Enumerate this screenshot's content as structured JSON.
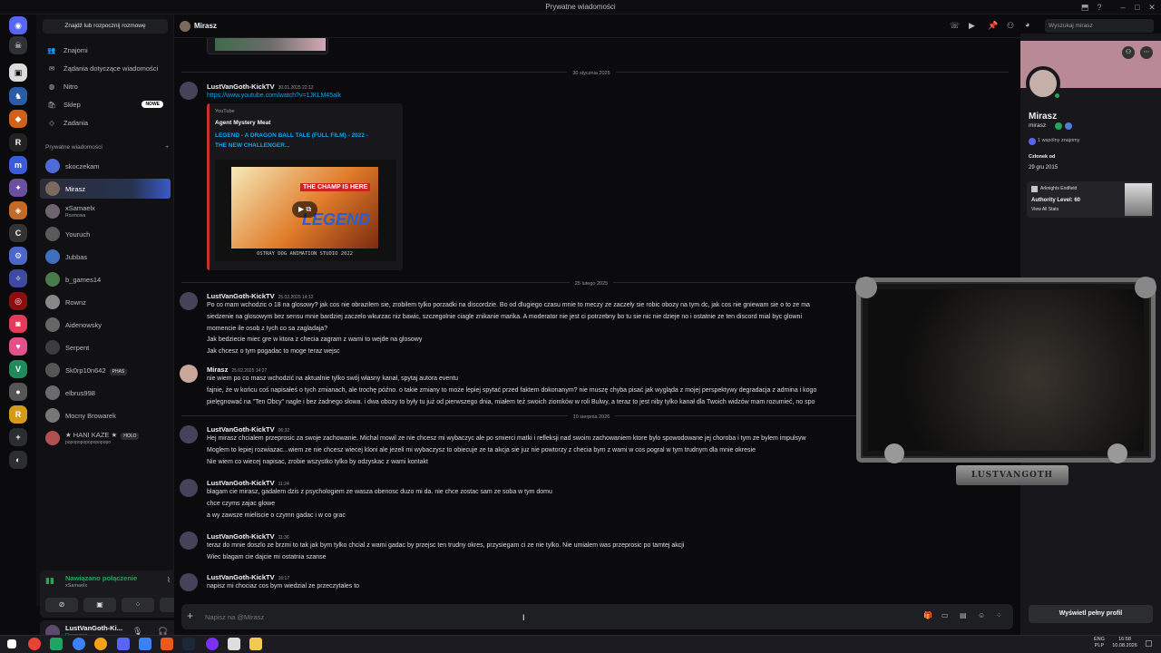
{
  "window": {
    "title": "Prywatne wiadomości"
  },
  "sidebar": {
    "find_button": "Znajdź lub rozpocznij rozmowę",
    "nav": [
      {
        "label": "Znajomi"
      },
      {
        "label": "Żądania dotyczące wiadomości"
      },
      {
        "label": "Nitro"
      },
      {
        "label": "Sklep",
        "badge": "NOWE"
      },
      {
        "label": "Zadania"
      }
    ],
    "dm_header": "Prywatne wiadomości",
    "dm_add": "+",
    "dms": [
      {
        "name": "skoczekam",
        "sub": "",
        "color": "#4f6bd9"
      },
      {
        "name": "Mirasz",
        "sub": "",
        "color": "#7a6a5e"
      },
      {
        "name": "xSamaelx",
        "sub": "Rozmowa",
        "color": "#6d6470"
      },
      {
        "name": "Youruch",
        "sub": "",
        "color": "#5a5a5a"
      },
      {
        "name": "Jubbas",
        "sub": "",
        "color": "#3f6fbf"
      },
      {
        "name": "b_games14",
        "sub": "",
        "color": "#4b7a4b"
      },
      {
        "name": "Rownz",
        "sub": "",
        "color": "#888"
      },
      {
        "name": "Aidenowsky",
        "sub": "",
        "color": "#666"
      },
      {
        "name": "Serpent",
        "sub": "",
        "color": "#3d3d3d"
      },
      {
        "name": "Sk0rp10n642",
        "sub": "",
        "tag": "PHAS",
        "color": "#555"
      },
      {
        "name": "elbrus998",
        "sub": "",
        "color": "#6b6b6b"
      },
      {
        "name": "Mocny Browarek",
        "sub": "",
        "color": "#777"
      },
      {
        "name": "★ HANI KAZE ★",
        "sub": "popopopopopopopopo",
        "tag": "HOLO",
        "color": "#b05050"
      }
    ],
    "voice": {
      "status": "Nawiązano połączenie",
      "channel": "xSamaelx"
    },
    "user": {
      "name": "LustVanGoth-Ki...",
      "status": "Rozmowa"
    }
  },
  "chat": {
    "header_name": "Mirasz",
    "search_placeholder": "Wyszukaj mirasz",
    "composer_placeholder": "Napisz na @Mirasz",
    "date_dividers": [
      "30 stycznia 2025",
      "25 lutego 2025",
      "10 sierpnia 2026"
    ],
    "embed": {
      "provider": "YouTube",
      "channel": "Agent Mystery Meat",
      "title_line1": "LEGEND - A DRAGON BALL TALE (FULL FILM) - 2022 -",
      "title_line2": "THE NEW CHALLENGER...",
      "thumb_text1": "THE CHAMP IS HERE",
      "thumb_text2": "LEGEND",
      "thumb_text3": "OSTRAY DOG ANIMATION STUDIO  2022"
    },
    "messages": [
      {
        "author": "LustVanGoth-KickTV",
        "time": "30.01.2025 22:12",
        "lines": [
          "https://www.youtube.com/watch?v=1JKLM45alk"
        ]
      },
      {
        "author": "LustVanGoth-KickTV",
        "time": "25.02.2025 14:12",
        "lines": [
          "Po co mam wchodzic o 18 na glosowy?  jak cos nie obrazilem sie, zrobilem tylko porzadki na discordzie. Bo od dlugiego czasu mnie to meczy ze zaczely sie robic obozy na tym dc,  jak cos nie gniewam sie o to ze ma",
          "siedzenie na glosowym bez sensu mnie bardziej zaczelo wkurzac niz bawic, szczegolnie ciagle znikanie marika. A moderator nie jest ci potrzebny bo tu sie nic nie dzieje   no i ostatnie ze ten discord mial byc glowni",
          "momencie ile osob z tych co sa zagladaja? ",
          "Jak bedziecie miec gre w ktora z checia zagram z wami to wejde na glosowy",
          "Jak chcesz o tym pogadac to moge teraz wejsc "
        ]
      },
      {
        "author": "Mirasz",
        "time": "25.02.2025 14:27",
        "lines": [
          "nie wiem po co masz wchodzić na aktualnie tylko swój własny kanał, spytaj autora eventu ",
          "fajnie, że w końcu coś napisałeś o tych zmianach, ale trochę późno. o takie zmiany to może lepiej spytać przed faktem dokonanym? nie muszę chyba pisać jak wygląda z mojej perspektywy degradacja z admina i kogo",
          "pielęgnować na \"Ten Obcy\" nagle i bez żadnego słowa. i dwa obozy to były tu już od pierwszego dnia, miałem też swoich ziomków w roli Bulwy, a teraz to jest niby tylko kanał dla Twoich widzów mam rozumieć, no spo"
        ]
      },
      {
        "author": "LustVanGoth-KickTV",
        "time": "06:32",
        "lines": [
          "Hej mirasz chcialem przeprosic za swoje zachowanie. Michal mowil ze nie chcesz mi wybaczyc ale po smierci matki i refleksji nad swoim zachowaniem ktore bylo spowodowane jej choroba i tym ze bylem impulsyw",
          "Moglem to lepiej rozwiazac...wiem ze nie chcesz wiecej kloni ale jezeli mi wybaczysz to obiecuje ze ta akcja sie juz nie powtorzy   z checia bym z wami w cos pogral w tym trudnym dla mnie okresie",
          "Nie wiem co wiecej napisac, zrobie wszystko tylko by odzyskac z wami kontakt"
        ]
      },
      {
        "author": "LustVanGoth-KickTV",
        "time": "11:24",
        "lines": [
          "blagam cie mirasz, gadalem dzis z psychologiem ze wasza obenosc duzo mi da.   nie chce zostac sam ze soba w tym domu ",
          "chce czyms zajac glowe",
          "a wy zawsze mieliscie o czymn gadac i w co grac"
        ]
      },
      {
        "author": "LustVanGoth-KickTV",
        "time": "11:36",
        "lines": [
          "teraz do mnie doszlo ze brzmi to tak jak bym tylko chcial z wami gadac by przejsc ten trudny okres, przysiegam ci ze nie tylko. Nie umialem was przeprosic po tamtej akcji",
          "Wiec blagam cie dajcie mi ostatnia szanse"
        ]
      },
      {
        "author": "LustVanGoth-KickTV",
        "time": "16:17",
        "lines": [
          "napisz mi chociaz cos bym wiedzial ze przeczytales to"
        ]
      }
    ]
  },
  "profile": {
    "name": "Mirasz",
    "username": "mirasz",
    "mutual": "1 wspólny znajomy",
    "member_since_label": "Członek od",
    "member_since": "29 gru 2015",
    "game": "Arknights Endfield",
    "game_level": "Authority Level: 60",
    "game_link": "View All Stats",
    "full_profile_button": "Wyświetl pełny profil"
  },
  "stream_overlay": {
    "name": "LUSTVANGOTH"
  },
  "taskbar": {
    "lang1": "ENG",
    "lang2": "PLP",
    "time": "16:58",
    "date": "10.08.2026"
  },
  "colors": {
    "accent": "#5865f2",
    "online": "#23a55a",
    "link": "#00a8fc",
    "embed_bar": "#c4302b"
  }
}
